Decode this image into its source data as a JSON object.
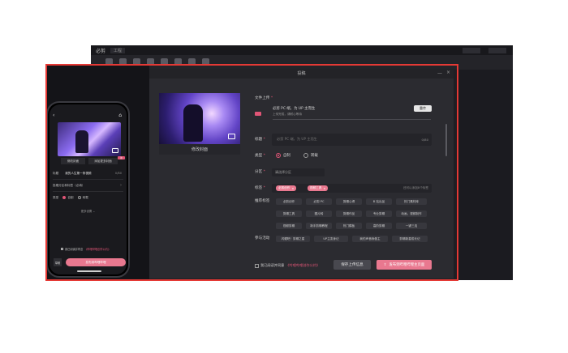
{
  "background_app": {
    "logo": "必剪",
    "project": "工程"
  },
  "phone_preview": {
    "cover_btn_1": "修改封面",
    "cover_btn_2": "添加更多封面",
    "badge": "新",
    "title_label": "标题",
    "title_value": "我的人生第一条视频",
    "title_count": "0/80",
    "partition_label": "投稿分区和标签（必填）",
    "type_label": "类型",
    "type_original": "自制",
    "type_repost": "转载",
    "more_settings": "更多设置",
    "agree_text": "我已阅读并同意",
    "agree_link": "《哔哩哔哩创作公约》",
    "bottom_icon": "草稿",
    "publish_button": "发布到哔哩哔哩"
  },
  "dialog": {
    "title": "投稿",
    "min_icon": "—",
    "close_icon": "×",
    "cover_label": "修改封面",
    "file_upload_label": "文件上传",
    "upload_file_name": "必剪 PC 端，为 UP 主而生",
    "upload_status": "上传完成，请耐心等待",
    "replace_button": "重传",
    "title_label": "标题",
    "title_placeholder": "必剪 PC 端，为 UP 主而生",
    "title_count": "0/80",
    "type_label": "类型",
    "type_original": "自制",
    "type_repost": "转载",
    "partition_label": "分区",
    "partition_placeholder": "请选择分区",
    "tags_label": "标签",
    "tags": [
      "必剪创作",
      "视频工具"
    ],
    "tags_hint": "还可以添加8个标签",
    "recommended_label": "推荐标签",
    "recommended_tags": [
      [
        "必剪创作",
        "必剪 PC",
        "剪辑心得",
        "B 站出品",
        "热门素材库"
      ],
      [
        "剪辑工具",
        "图片转",
        "剪辑作品",
        "专业剪辑",
        "动画、视频制作"
      ],
      [
        "视频剪辑",
        "新手剪辑教程",
        "热门模板",
        "高阶剪辑",
        "一键三连"
      ]
    ],
    "activity_label": "参与活动",
    "activities": [
      "闪耀吧！剪辑之星",
      "UP主变身记",
      "我的声音我做主",
      "剪辑新星成长记"
    ],
    "agree_text": "我已阅读并同意",
    "agree_link": "《哔哩哔哩创作公约》",
    "save_draft_button": "保存上传信息",
    "publish_button": "发布到哔哩哔哩主页面"
  },
  "colors": {
    "accent": "#e9788f",
    "highlight_frame": "#e53935",
    "dialog_bg": "#2b2b30"
  }
}
